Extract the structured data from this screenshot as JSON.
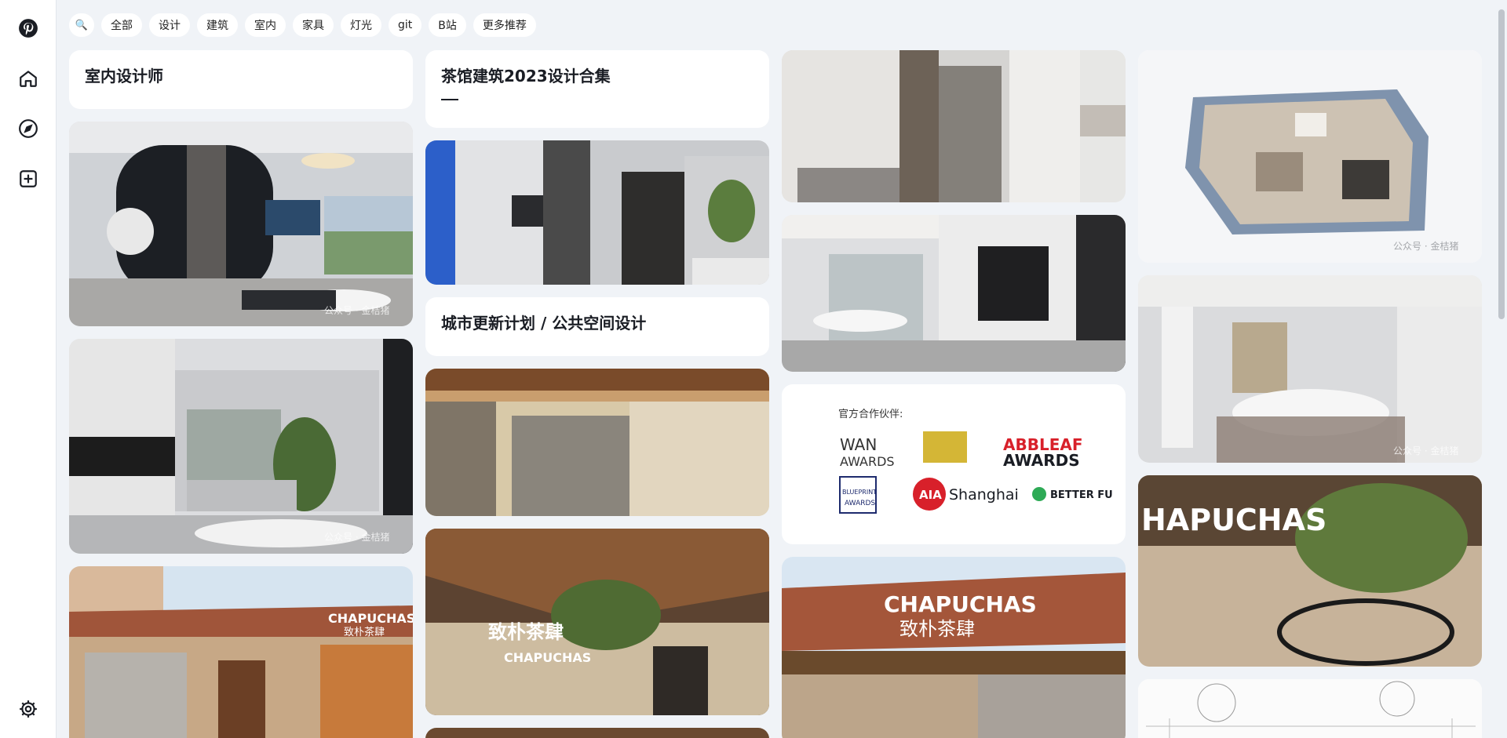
{
  "sidebar": {
    "items": [
      {
        "name": "pinterest-logo-icon"
      },
      {
        "name": "home-icon"
      },
      {
        "name": "explore-icon"
      },
      {
        "name": "create-icon"
      },
      {
        "name": "settings-icon"
      }
    ]
  },
  "topbar": {
    "search_icon": "🔍",
    "chips": [
      "全部",
      "设计",
      "建筑",
      "室内",
      "家具",
      "灯光",
      "git",
      "B站",
      "更多推荐"
    ]
  },
  "cards": {
    "c1_title": "室内设计师",
    "c2_title": "茶馆建筑2023设计合集",
    "c3_title": "城市更新计划 / 公共空间设计",
    "partners_heading": "官方合作伙伴:",
    "partner_wan": "WAN",
    "partner_awards": "AWARDS",
    "partner_abbleaf_1": "ABBLEAF",
    "partner_abbleaf_2": "AWARDS",
    "partner_blueprint_1": "BLUEPRINT",
    "partner_blueprint_2": "AWARDS",
    "partner_aia": "AIA",
    "partner_shanghai": "Shanghai",
    "partner_better": "BETTER FU",
    "watermark": "公众号 · 金桔猪",
    "sign_en": "CHAPUCHAS",
    "sign_cn": "致朴茶肆",
    "sign_partial": "HAPUCHAS"
  },
  "colors": {
    "bg": "#f0f3f7",
    "card": "#ffffff",
    "accent_red": "#d8202a"
  }
}
